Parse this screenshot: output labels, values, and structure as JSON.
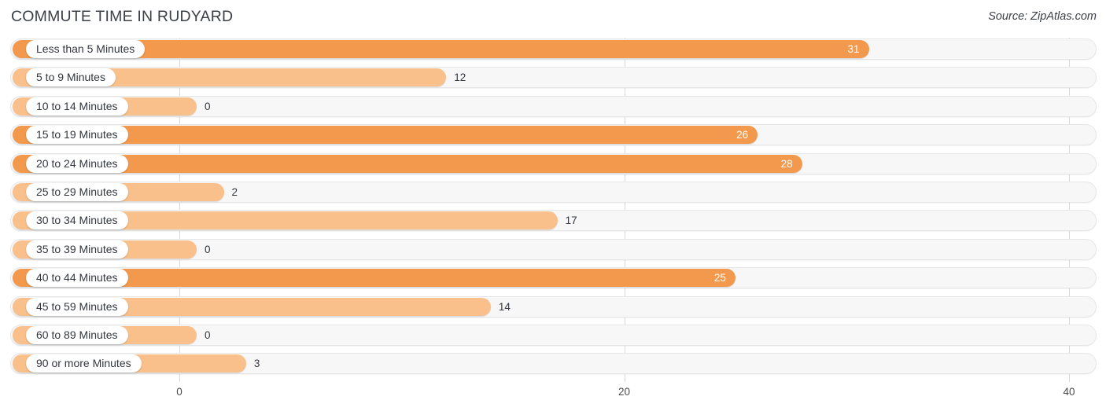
{
  "header": {
    "title": "COMMUTE TIME IN RUDYARD",
    "source": "Source: ZipAtlas.com"
  },
  "axis": {
    "ticks": [
      "0",
      "20",
      "40"
    ]
  },
  "colors": {
    "bar_strong": "#f2994e",
    "bar_light": "#fac08b",
    "track": "#f7f7f7",
    "grid": "#d9d9d9",
    "text": "#33373d"
  },
  "chart_data": {
    "type": "bar",
    "orientation": "horizontal",
    "title": "COMMUTE TIME IN RUDYARD",
    "xlabel": "",
    "ylabel": "",
    "xlim": [
      0,
      40
    ],
    "xticks": [
      0,
      20,
      40
    ],
    "grid": true,
    "legend": false,
    "source": "Source: ZipAtlas.com",
    "categories": [
      "Less than 5 Minutes",
      "5 to 9 Minutes",
      "10 to 14 Minutes",
      "15 to 19 Minutes",
      "20 to 24 Minutes",
      "25 to 29 Minutes",
      "30 to 34 Minutes",
      "35 to 39 Minutes",
      "40 to 44 Minutes",
      "45 to 59 Minutes",
      "60 to 89 Minutes",
      "90 or more Minutes"
    ],
    "values": [
      31,
      12,
      0,
      26,
      28,
      2,
      17,
      0,
      25,
      14,
      0,
      3
    ],
    "rows": [
      {
        "label": "Less than 5 Minutes",
        "value": 31,
        "value_text": "31",
        "label_inside": true
      },
      {
        "label": "5 to 9 Minutes",
        "value": 12,
        "value_text": "12",
        "label_inside": false
      },
      {
        "label": "10 to 14 Minutes",
        "value": 0,
        "value_text": "0",
        "label_inside": false
      },
      {
        "label": "15 to 19 Minutes",
        "value": 26,
        "value_text": "26",
        "label_inside": true
      },
      {
        "label": "20 to 24 Minutes",
        "value": 28,
        "value_text": "28",
        "label_inside": true
      },
      {
        "label": "25 to 29 Minutes",
        "value": 2,
        "value_text": "2",
        "label_inside": false
      },
      {
        "label": "30 to 34 Minutes",
        "value": 17,
        "value_text": "17",
        "label_inside": false
      },
      {
        "label": "35 to 39 Minutes",
        "value": 0,
        "value_text": "0",
        "label_inside": false
      },
      {
        "label": "40 to 44 Minutes",
        "value": 25,
        "value_text": "25",
        "label_inside": true
      },
      {
        "label": "45 to 59 Minutes",
        "value": 14,
        "value_text": "14",
        "label_inside": false
      },
      {
        "label": "60 to 89 Minutes",
        "value": 0,
        "value_text": "0",
        "label_inside": false
      },
      {
        "label": "90 or more Minutes",
        "value": 3,
        "value_text": "3",
        "label_inside": false
      }
    ]
  }
}
